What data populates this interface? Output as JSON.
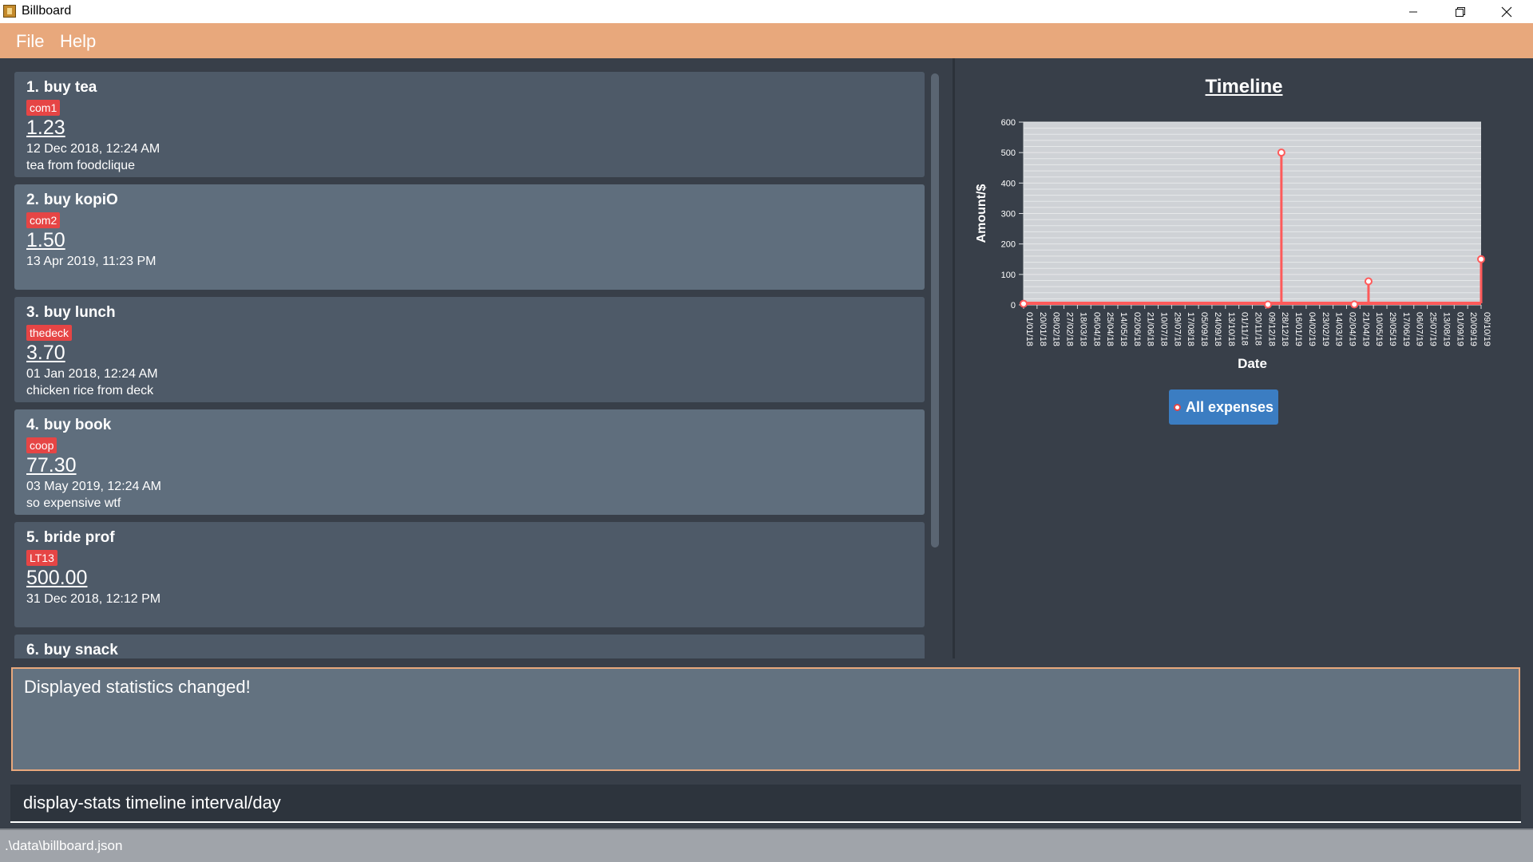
{
  "window": {
    "title": "Billboard",
    "minimize_icon": "minimize-icon",
    "maximize_icon": "restore-icon",
    "close_icon": "close-icon"
  },
  "menu": {
    "file": "File",
    "help": "Help"
  },
  "expenses": [
    {
      "index": "1.",
      "name": "buy tea",
      "tag": "com1",
      "amount": "1.23",
      "date": "12 Dec 2018, 12:24 AM",
      "description": "tea from foodclique"
    },
    {
      "index": "2.",
      "name": "buy kopiO",
      "tag": "com2",
      "amount": "1.50",
      "date": "13 Apr 2019, 11:23 PM",
      "description": ""
    },
    {
      "index": "3.",
      "name": "buy lunch",
      "tag": "thedeck",
      "amount": "3.70",
      "date": "01 Jan 2018, 12:24 AM",
      "description": "chicken rice from deck"
    },
    {
      "index": "4.",
      "name": "buy book",
      "tag": "coop",
      "amount": "77.30",
      "date": "03 May 2019, 12:24 AM",
      "description": "so expensive wtf"
    },
    {
      "index": "5.",
      "name": "bride prof",
      "tag": "LT13",
      "amount": "500.00",
      "date": "31 Dec 2018, 12:12 PM",
      "description": ""
    },
    {
      "index": "6.",
      "name": "buy snack",
      "tag": "",
      "amount": "",
      "date": "",
      "description": ""
    }
  ],
  "stats": {
    "title": "Timeline",
    "legend_label": "All expenses"
  },
  "chart_data": {
    "type": "line",
    "title": "Timeline",
    "xlabel": "Date",
    "ylabel": "Amount/$",
    "ylim": [
      0,
      600
    ],
    "yticks": [
      0,
      100,
      200,
      300,
      400,
      500,
      600
    ],
    "x_tick_labels": [
      "01/01/18",
      "20/01/18",
      "08/02/18",
      "27/02/18",
      "18/03/18",
      "06/04/18",
      "25/04/18",
      "14/05/18",
      "02/06/18",
      "21/06/18",
      "10/07/18",
      "29/07/18",
      "17/08/18",
      "05/09/18",
      "24/09/18",
      "13/10/18",
      "01/11/18",
      "20/11/18",
      "09/12/18",
      "28/12/18",
      "16/01/19",
      "04/02/19",
      "23/02/19",
      "14/03/19",
      "02/04/19",
      "21/04/19",
      "10/05/19",
      "29/05/19",
      "17/06/19",
      "06/07/19",
      "25/07/19",
      "13/08/19",
      "01/09/19",
      "20/09/19",
      "09/10/19"
    ],
    "grid": true,
    "legend_position": "bottom",
    "series": [
      {
        "name": "All expenses",
        "color": "#ff5a5a",
        "points": [
          {
            "x": "01/01/18",
            "y": 3.7
          },
          {
            "x": "12/12/18",
            "y": 1.23
          },
          {
            "x": "31/12/18",
            "y": 500.0
          },
          {
            "x": "13/04/19",
            "y": 1.5
          },
          {
            "x": "03/05/19",
            "y": 77.3
          },
          {
            "x": "09/10/19",
            "y": 150
          }
        ]
      }
    ]
  },
  "result": {
    "text": "Displayed statistics changed!"
  },
  "command": {
    "value": "display-stats timeline interval/day"
  },
  "status": {
    "path": ".\\data\\billboard.json"
  },
  "colors": {
    "menu_accent": "#e8a87c",
    "tag_red": "#e64545",
    "legend_blue": "#3b7dc2",
    "series_red": "#ff5a5a"
  }
}
